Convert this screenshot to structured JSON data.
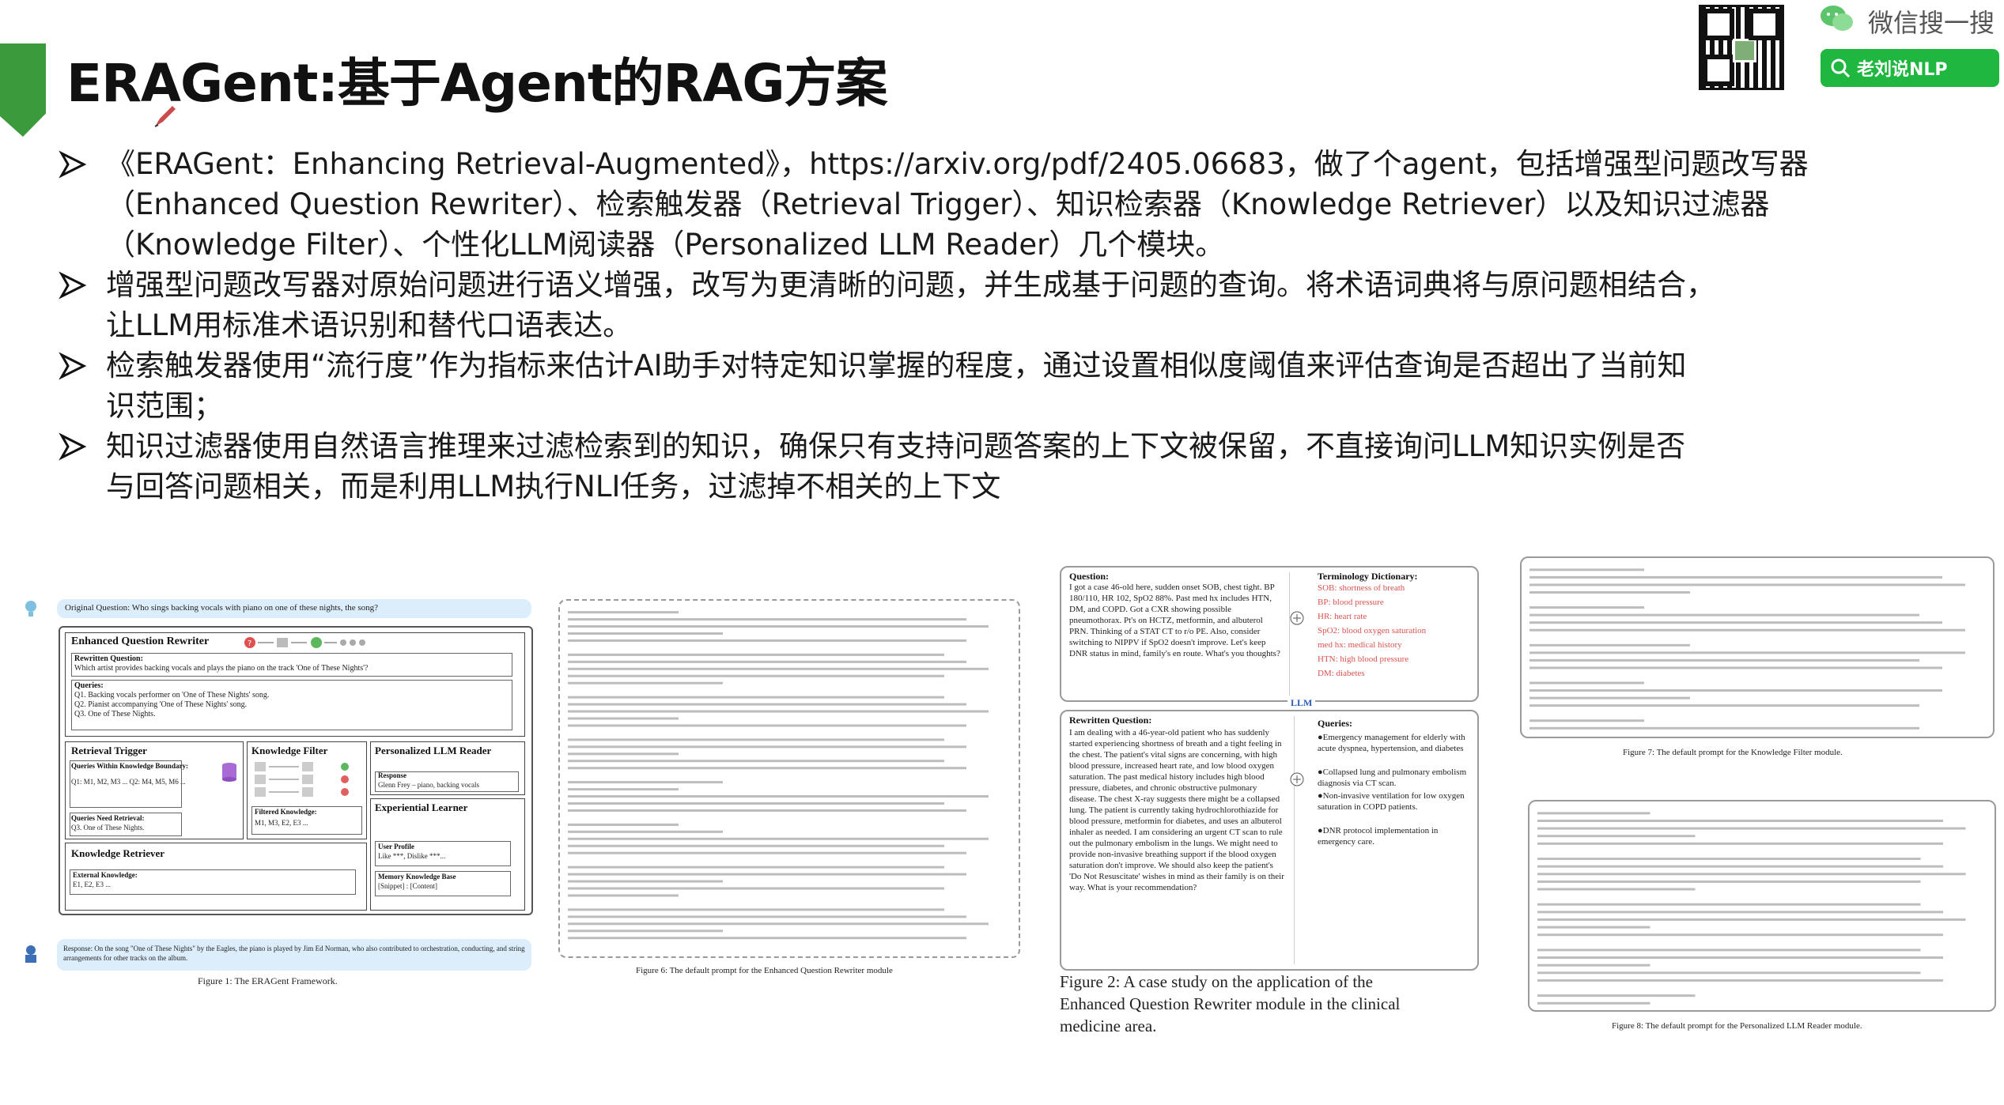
{
  "header": {
    "title": "ERAGent:基于Agent的RAG方案",
    "wechat_label": "微信搜一搜",
    "search_label": "老刘说NLP"
  },
  "bullets": [
    {
      "lines": [
        "《ERAGent：Enhancing Retrieval-Augmented》，https://arxiv.org/pdf/2405.06683，做了个agent，包括增强型问题改写器",
        "（Enhanced Question Rewriter）、检索触发器（Retrieval Trigger）、知识检索器（Knowledge Retriever）以及知识过滤器",
        "（Knowledge Filter）、个性化LLM阅读器（Personalized LLM Reader）几个模块。"
      ]
    },
    {
      "lines": [
        "增强型问题改写器对原始问题进行语义增强，改写为更清晰的问题，并生成基于问题的查询。将术语词典将与原问题相结合，",
        "让LLM用标准术语识别和替代口语表达。"
      ]
    },
    {
      "lines": [
        "检索触发器使用“流行度”作为指标来估计AI助手对特定知识掌握的程度，通过设置相似度阈值来评估查询是否超出了当前知",
        "识范围；"
      ]
    },
    {
      "lines": [
        "知识过滤器使用自然语言推理来过滤检索到的知识，确保只有支持问题答案的上下文被保留，不直接询问LLM知识实例是否",
        "与回答问题相关，而是利用LLM执行NLI任务，过滤掉不相关的上下文"
      ]
    }
  ],
  "figure1": {
    "original_question": "Original Question: Who sings backing vocals with piano on one of these nights, the song?",
    "eqr_label": "Enhanced Question Rewriter",
    "rewritten_q_label": "Rewritten Question:",
    "rewritten_q_text": "Which artist provides backing vocals and plays the piano on the track 'One of These Nights'?",
    "queries_label": "Queries:",
    "queries": [
      "Q1. Backing vocals performer on 'One of These Nights' song.",
      "Q2. Pianist accompanying 'One of These Nights' song.",
      "Q3. One of These Nights."
    ],
    "retrieval_trigger_label": "Retrieval Trigger",
    "queries_within_label": "Queries Within Knowledge Boundary:",
    "queries_within_text": "Q1: M1, M2, M3 ...  Q2: M4, M5, M6 ...",
    "queries_need_label": "Queries Need Retrieval:",
    "queries_need_text": "Q3. One of These Nights.",
    "knowledge_filter_label": "Knowledge Filter",
    "filtered_knowledge_label": "Filtered Knowledge:",
    "filtered_knowledge_text": "M1, M3, E2, E3 ...",
    "llm_reader_label": "Personalized LLM Reader",
    "response_label": "Response",
    "response_text": "Glenn Frey – piano, backing vocals",
    "experiential_learner_label": "Experiential Learner",
    "user_profile_label": "User Profile",
    "user_profile_text": "Like ***, Dislike ***...",
    "memory_kb_label": "Memory Knowledge Base",
    "memory_kb_text": "[Snippet] : [Content]",
    "knowledge_retriever_label": "Knowledge Retriever",
    "external_knowledge_label": "External Knowledge:",
    "external_knowledge_text": "E1, E2, E3 ...",
    "final_response": "Response: On the song \"One of These Nights\" by the Eagles, the piano is played by Jim Ed Norman, who also contributed to orchestration, conducting, and string arrangements for other tracks on the album.",
    "caption": "Figure 1: The ERAGent Framework."
  },
  "figure6": {
    "caption": "Figure 6: The default prompt for the Enhanced Question Rewriter module"
  },
  "figure2": {
    "question_label": "Question:",
    "question_text": "I got a case 46-old here, sudden onset SOB, chest tight. BP 180/110, HR 102, SpO2 88%. Past med hx includes HTN, DM, and COPD. Got a CXR showing possible pneumothorax. Pt's on HCTZ, metformin, and albuterol PRN. Thinking of a STAT CT to r/o PE. Also, consider switching to NIPPV if SpO2 doesn't improve. Let's keep DNR status in mind, family's en route. What's you thoughts?",
    "terminology_label": "Terminology Dictionary:",
    "terminology": [
      "SOB: shortness of breath",
      "BP: blood pressure",
      "HR: heart rate",
      "SpO2: blood oxygen saturation",
      "med hx: medical history",
      "HTN: high blood pressure",
      "DM: diabetes"
    ],
    "llm_label": "LLM",
    "rewritten_label": "Rewritten Question:",
    "rewritten_text": "I am dealing with a 46-year-old patient who has suddenly started experiencing shortness of breath and a tight feeling in the chest. The patient's vital signs are concerning, with high blood pressure, increased heart rate, and low blood oxygen saturation. The past medical history includes high blood pressure, diabetes, and chronic obstructive pulmonary disease. The chest X-ray suggests there might be a collapsed lung. The patient is currently taking hydrochlorothiazide for blood pressure, metformin for diabetes, and uses an albuterol inhaler as needed. I am considering an urgent CT scan to rule out the pulmonary embolism in the lungs. We might need to provide non-invasive breathing support if the blood oxygen saturation don't improve. We should also keep the patient's 'Do Not Resuscitate' wishes in mind as their family is on their way. What is your recommendation?",
    "queries_label": "Queries:",
    "queries": [
      "●Emergency management for elderly with acute dyspnea, hypertension, and diabetes",
      "●Collapsed lung and pulmonary embolism diagnosis via CT scan.",
      "●Non-invasive ventilation for low oxygen saturation in COPD patients.",
      "●DNR protocol implementation in emergency care."
    ],
    "caption_lines": [
      "Figure 2:  A case study on the application of the",
      "Enhanced Question Rewriter module in the clinical",
      "medicine area."
    ]
  },
  "figure7": {
    "caption": "Figure 7: The default prompt for the Knowledge Filter module."
  },
  "figure8": {
    "caption": "Figure 8: The default prompt for the Personalized LLM Reader module."
  }
}
